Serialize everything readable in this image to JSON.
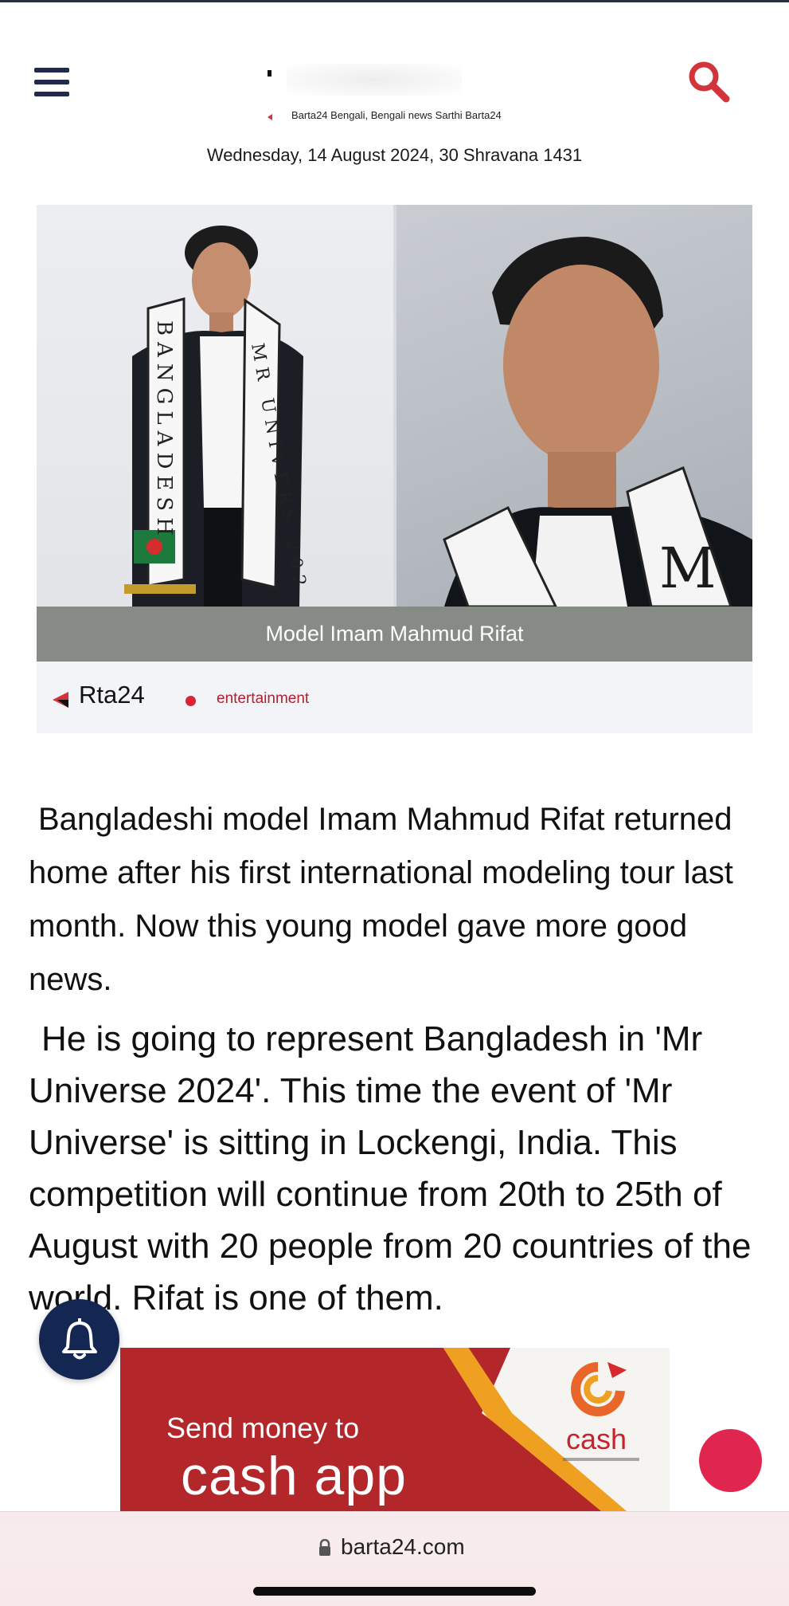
{
  "header": {
    "tagline": "Barta24 Bengali, Bengali news Sarthi Barta24",
    "date": "Wednesday, 14 August 2024, 30 Shravana 1431"
  },
  "hero": {
    "caption": "Model Imam Mahmud Rifat",
    "sash_left": "BANGLADESH",
    "sash_right": "MR UNIVERS 202",
    "sash_right_photo": "M"
  },
  "meta": {
    "source": "Rta24",
    "category": "entertainment"
  },
  "article": {
    "paragraphs": [
      "Bangladeshi model Imam Mahmud Rifat returned home after his first international modeling tour last month. Now this young model gave more good news.",
      "He is going to represent Bangladesh in 'Mr Universe 2024'. This time the event of 'Mr Universe' is sitting in Lockengi, India. This competition will continue from 20th to 25th of August with 20 people from 20 countries of the world. Rifat is one of them."
    ]
  },
  "ad": {
    "line1": "Send money to",
    "line2": "cash app",
    "brand": "cash"
  },
  "browser": {
    "url": "barta24.com"
  },
  "icons": {
    "menu": "hamburger-icon",
    "search": "search-icon",
    "notification": "bell-icon",
    "lock": "lock-icon"
  },
  "colors": {
    "navy": "#1f2a4c",
    "accent_red": "#d1343b",
    "caption_bg": "#878b86",
    "ad_red": "#b3262a",
    "fab_pink": "#e0264f"
  }
}
